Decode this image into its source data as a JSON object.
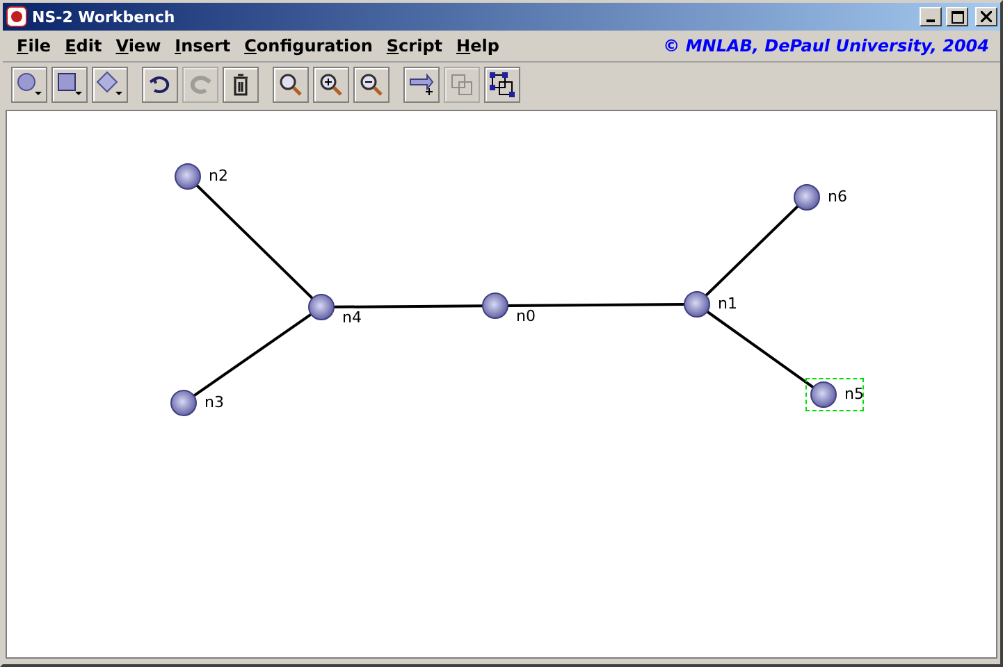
{
  "window": {
    "title": "NS-2 Workbench"
  },
  "menu": [
    "File",
    "Edit",
    "View",
    "Insert",
    "Configuration",
    "Script",
    "Help"
  ],
  "credit": "© MNLAB, DePaul University, 2004",
  "toolbar": [
    [
      {
        "kind": "circle",
        "disabled": false
      },
      {
        "kind": "square",
        "disabled": false
      },
      {
        "kind": "diamond",
        "disabled": false
      }
    ],
    [
      {
        "kind": "undo",
        "disabled": false
      },
      {
        "kind": "redo",
        "disabled": true
      },
      {
        "kind": "delete",
        "disabled": false
      }
    ],
    [
      {
        "kind": "zoom",
        "disabled": false
      },
      {
        "kind": "zoomin",
        "disabled": false
      },
      {
        "kind": "zoomout",
        "disabled": false
      }
    ],
    [
      {
        "kind": "link",
        "disabled": false
      },
      {
        "kind": "group",
        "disabled": true
      },
      {
        "kind": "ungroup",
        "disabled": false
      }
    ]
  ],
  "nodes": [
    {
      "label": "n2",
      "selected": false
    },
    {
      "label": "n4",
      "selected": false
    },
    {
      "label": "n0",
      "selected": false
    },
    {
      "label": "n1",
      "selected": false
    },
    {
      "label": "n6",
      "selected": false
    },
    {
      "label": "n3",
      "selected": false
    },
    {
      "label": "n5",
      "selected": true
    }
  ]
}
